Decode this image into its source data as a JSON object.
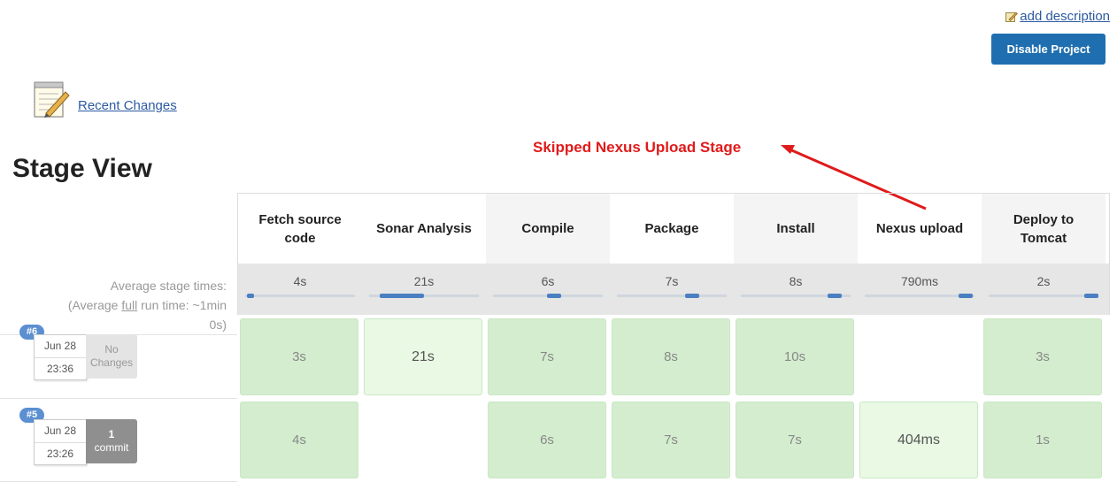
{
  "top": {
    "add_description": "add description",
    "disable_button": "Disable Project",
    "recent_changes": "Recent Changes"
  },
  "annotation": "Skipped Nexus Upload Stage",
  "title": "Stage View",
  "avg_label_line1": "Average stage times:",
  "avg_label_line2a": "(Average ",
  "avg_label_full": "full",
  "avg_label_line2b": " run time: ~1min",
  "avg_label_line3": "0s)",
  "stages": [
    {
      "name": "Fetch source code",
      "avg": "4s",
      "progress": 0.08
    },
    {
      "name": "Sonar Analysis",
      "avg": "21s",
      "progress": 0.5
    },
    {
      "name": "Compile",
      "avg": "6s",
      "progress": 0.62
    },
    {
      "name": "Package",
      "avg": "7s",
      "progress": 0.75
    },
    {
      "name": "Install",
      "avg": "8s",
      "progress": 0.92
    },
    {
      "name": "Nexus upload",
      "avg": "790ms",
      "progress": 0.98
    },
    {
      "name": "Deploy to Tomcat",
      "avg": "2s",
      "progress": 1.0
    }
  ],
  "runs": [
    {
      "badge": "#6",
      "date": "Jun 28",
      "time": "23:36",
      "changes_line1": "No",
      "changes_line2": "Changes",
      "cells": [
        "3s",
        "21s",
        "7s",
        "8s",
        "10s",
        "",
        "3s"
      ]
    },
    {
      "badge": "#5",
      "date": "Jun 28",
      "time": "23:26",
      "changes_line1": "1",
      "changes_line2": "commit",
      "cells": [
        "4s",
        "",
        "6s",
        "7s",
        "7s",
        "404ms",
        "1s"
      ]
    }
  ],
  "colors": {
    "accent": "#1f6fb0",
    "annotation": "#e01b1b",
    "success": "#dcf2d7"
  }
}
